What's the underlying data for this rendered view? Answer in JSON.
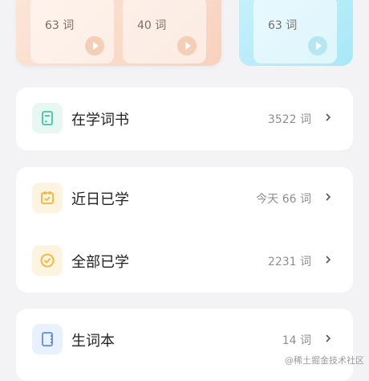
{
  "top": {
    "cards": [
      {
        "count": "63 词"
      },
      {
        "count": "40 词"
      },
      {
        "count": "63 词"
      }
    ]
  },
  "lists": {
    "book": {
      "label": "在学词书",
      "value": "3522 词"
    },
    "recent": {
      "label": "近日已学",
      "value": "今天 66 词"
    },
    "all": {
      "label": "全部已学",
      "value": "2231 词"
    },
    "vocab": {
      "label": "生词本",
      "value": "14 词"
    }
  },
  "watermark": "@稀土掘金技术社区",
  "colors": {
    "teal": "#3cc7a5",
    "orange": "#f3b437",
    "blue": "#5b8cf4"
  }
}
